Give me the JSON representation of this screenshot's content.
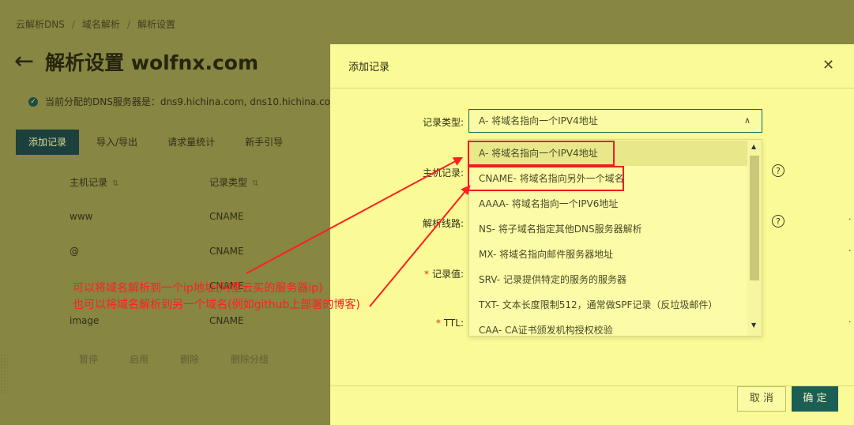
{
  "breadcrumb": {
    "items": [
      "云解析DNS",
      "域名解析",
      "解析设置"
    ],
    "sep": "/"
  },
  "page": {
    "title": "解析设置 wolfnx.com",
    "dns_info": "当前分配的DNS服务器是：dns9.hichina.com, dns10.hichina.com"
  },
  "tabs": [
    "添加记录",
    "导入/导出",
    "请求量统计",
    "新手引导"
  ],
  "table": {
    "headers": {
      "host": "主机记录",
      "type": "记录类型"
    },
    "rows": [
      {
        "host": "www",
        "type": "CNAME"
      },
      {
        "host": "@",
        "type": "CNAME"
      },
      {
        "host": "",
        "type": "CNAME"
      },
      {
        "host": "image",
        "type": "CNAME"
      }
    ],
    "actions": [
      "暂停",
      "启用",
      "删除",
      "删除分组"
    ]
  },
  "dialog": {
    "title": "添加记录",
    "labels": {
      "record_type": "记录类型:",
      "host": "主机记录:",
      "line": "解析线路:",
      "value": "记录值:",
      "ttl": "TTL:"
    },
    "select_value": "A- 将域名指向一个IPV4地址",
    "options": [
      "A- 将域名指向一个IPV4地址",
      "CNAME- 将域名指向另外一个域名",
      "AAAA- 将域名指向一个IPV6地址",
      "NS- 将子域名指定其他DNS服务器解析",
      "MX- 将域名指向邮件服务器地址",
      "SRV- 记录提供特定的服务的服务器",
      "TXT- 文本长度限制512，通常做SPF记录（反垃圾邮件）",
      "CAA- CA证书颁发机构授权校验"
    ],
    "cancel_label": "取 消",
    "ok_label": "确 定"
  },
  "annotation": {
    "line1": "可以将域名解析到一个ip地址(阿里云买的服务器ip)",
    "line2": "也可以将域名解析到另一个域名(例如github上部署的博客)"
  },
  "colors": {
    "accent": "#1b5e55",
    "annotation": "#ff2020"
  }
}
